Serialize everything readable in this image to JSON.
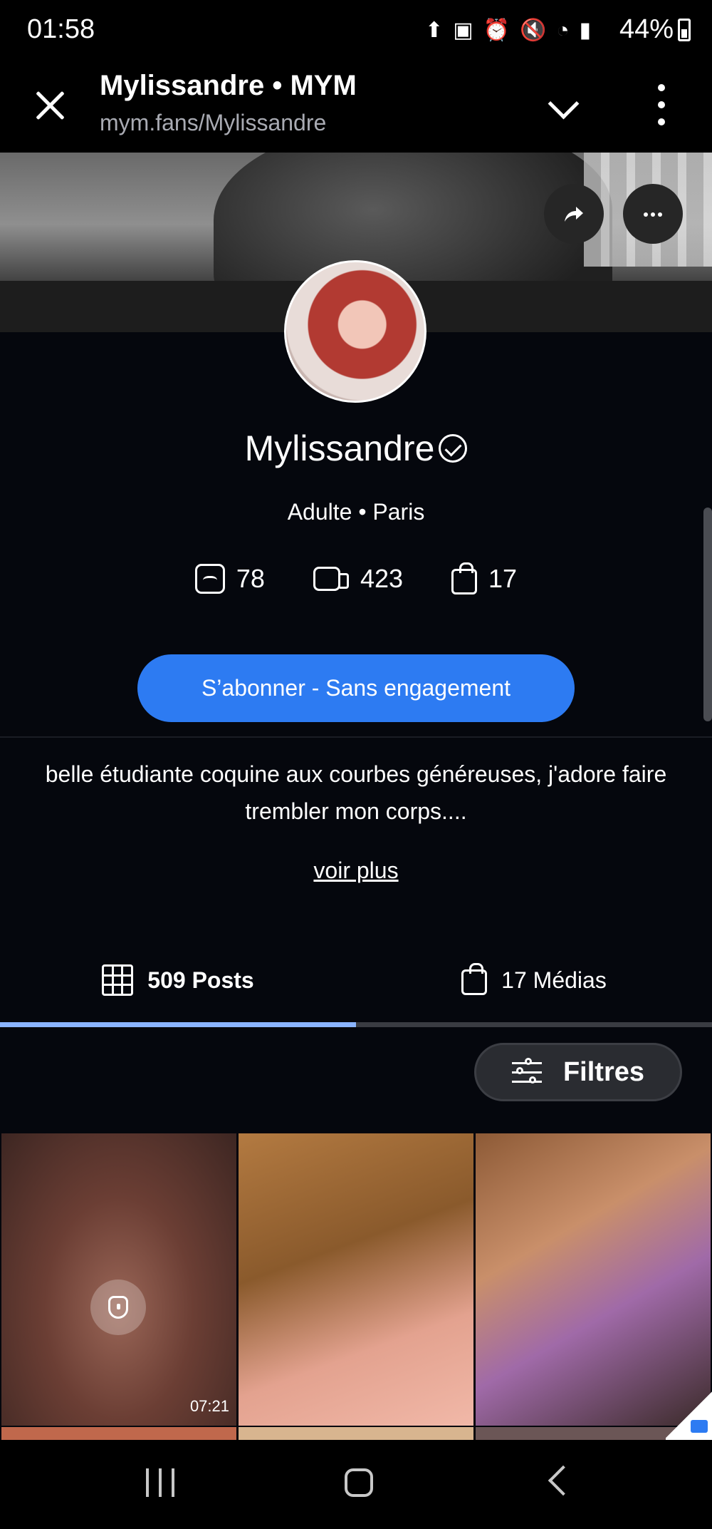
{
  "status_bar": {
    "time": "01:58",
    "battery": "44%",
    "icons": [
      "upload-icon",
      "clipboard-icon",
      "alarm-icon",
      "mute-icon",
      "wifi-icon",
      "volte-icon",
      "signal-icon"
    ]
  },
  "browser": {
    "title": "Mylissandre • MYM",
    "url": "mym.fans/Mylissandre"
  },
  "profile": {
    "name": "Mylissandre",
    "meta": "Adulte • Paris",
    "stats": {
      "photos": "78",
      "videos": "423",
      "purchases": "17"
    },
    "subscribe_label": "S’abonner - Sans engagement",
    "bio": "belle étudiante coquine aux courbes généreuses, j'adore faire trembler mon corps....",
    "voir_plus": "voir plus"
  },
  "tabs": {
    "posts": "509 Posts",
    "medias": "17 Médias",
    "active": "posts"
  },
  "filters_label": "Filtres",
  "grid": {
    "tiles": [
      {
        "locked": true,
        "duration": "07:21"
      },
      {
        "locked": false
      },
      {
        "locked": false
      }
    ]
  },
  "colors": {
    "accent": "#2d7bf2",
    "tab_indicator": "#8ab4ff",
    "background": "#05070d"
  }
}
